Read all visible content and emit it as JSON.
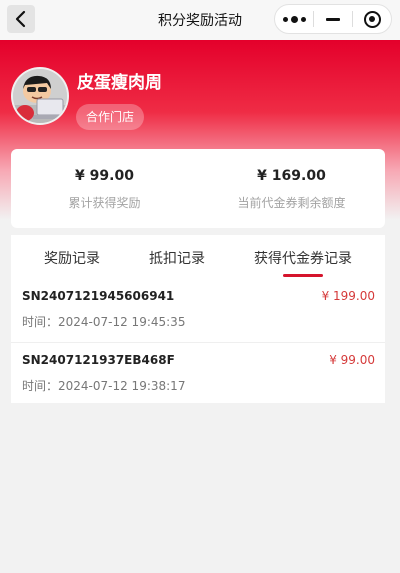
{
  "nav": {
    "title": "积分奖励活动",
    "back_icon": "chevron-left-icon",
    "more_icon": "more-dots-icon",
    "minimize_icon": "minus-icon",
    "close_icon": "target-circle-icon"
  },
  "colors": {
    "brand_red": "#e4002b",
    "tab_underline": "#d5142c",
    "amount_red": "#d53a3a"
  },
  "profile": {
    "username": "皮蛋瘦肉周",
    "badge": "合作门店"
  },
  "stats": [
    {
      "value": "¥ 99.00",
      "label": "累计获得奖励"
    },
    {
      "value": "¥ 169.00",
      "label": "当前代金券剩余额度"
    }
  ],
  "tabs": [
    {
      "label": "奖励记录",
      "active": false
    },
    {
      "label": "抵扣记录",
      "active": false
    },
    {
      "label": "获得代金券记录",
      "active": true
    }
  ],
  "records": [
    {
      "sn": "SN2407121945606941",
      "amount": "¥ 199.00",
      "time": "时间：2024-07-12 19:45:35"
    },
    {
      "sn": "SN2407121937EB468F",
      "amount": "¥ 99.00",
      "time": "时间：2024-07-12 19:38:17"
    }
  ]
}
